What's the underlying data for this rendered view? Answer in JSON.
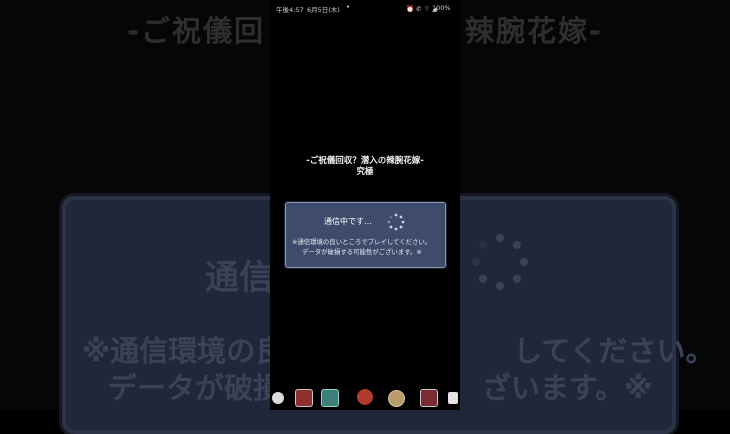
{
  "background": {
    "title": "-ご祝儀回",
    "title_right": "辣腕花嫁-",
    "status": "通信",
    "note1": "※通信環境の良い",
    "note1_right": "してください。",
    "note2": "データが破損",
    "note2_right": "ざいます。※"
  },
  "statusbar": {
    "time": "午後4:57",
    "date": "6月5日(木)",
    "dot": "•",
    "icons": "⏰ ✆ ⌔ ◢",
    "battery": "100%"
  },
  "quest": {
    "title": "-ご祝儀回収？潜入の辣腕花嫁-",
    "difficulty": "究極"
  },
  "dialog": {
    "status": "通信中です…",
    "note1": "※通信環境の良いところでプレイしてください。",
    "note2": "データが破損する可能性がございます。※"
  },
  "taskbar": {
    "icons": [
      "settings-app-icon",
      "game-app-icon-1",
      "game-app-icon-2",
      "game-app-icon-3",
      "coin-app-icon",
      "game-app-icon-4",
      "file-app-icon"
    ]
  }
}
